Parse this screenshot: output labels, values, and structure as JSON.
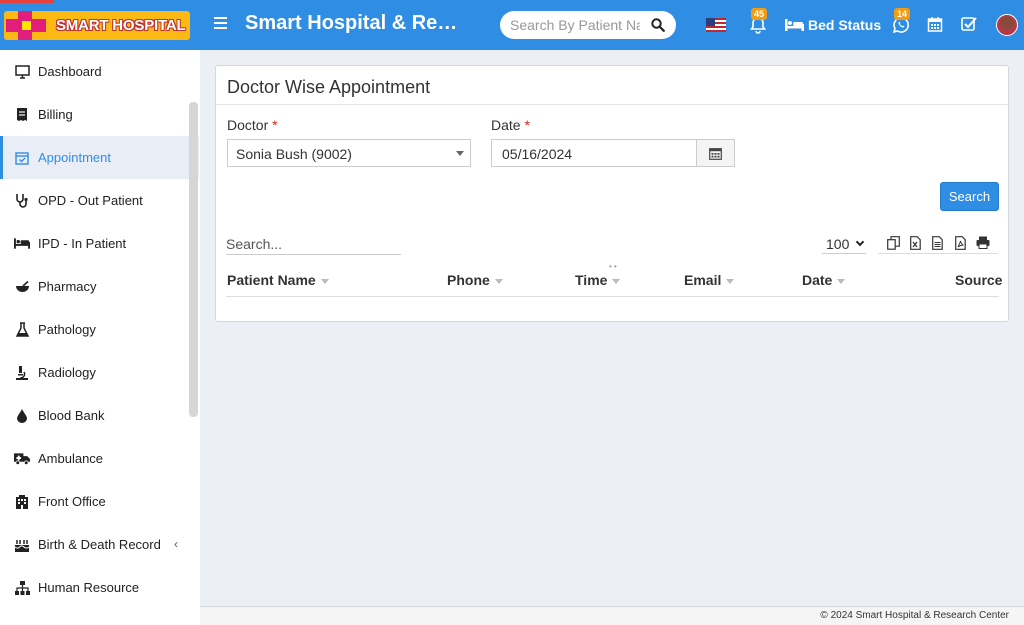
{
  "header": {
    "logo_text": "SMART HOSPITAL",
    "app_title": "Smart Hospital & Research Center",
    "search_placeholder": "Search By Patient Name",
    "notification_count": "45",
    "bed_status_label": "Bed Status",
    "whatsapp_count": "14"
  },
  "sidebar": {
    "items": [
      {
        "label": "Dashboard",
        "icon": "monitor-icon"
      },
      {
        "label": "Billing",
        "icon": "billing-icon"
      },
      {
        "label": "Appointment",
        "icon": "calendar-check-icon",
        "active": true
      },
      {
        "label": "OPD - Out Patient",
        "icon": "stethoscope-icon"
      },
      {
        "label": "IPD - In Patient",
        "icon": "bed-icon"
      },
      {
        "label": "Pharmacy",
        "icon": "mortar-icon"
      },
      {
        "label": "Pathology",
        "icon": "flask-icon"
      },
      {
        "label": "Radiology",
        "icon": "microscope-icon"
      },
      {
        "label": "Blood Bank",
        "icon": "drop-icon"
      },
      {
        "label": "Ambulance",
        "icon": "ambulance-icon"
      },
      {
        "label": "Front Office",
        "icon": "building-icon"
      },
      {
        "label": "Birth & Death Record",
        "icon": "cake-icon",
        "expandable": true
      },
      {
        "label": "Human Resource",
        "icon": "sitemap-icon"
      }
    ]
  },
  "main": {
    "title": "Doctor Wise Appointment",
    "doctor_label": "Doctor",
    "doctor_value": "Sonia Bush (9002)",
    "date_label": "Date",
    "date_value": "05/16/2024",
    "required_mark": "*",
    "search_button": "Search",
    "table_search_placeholder": "Search...",
    "page_length": "100",
    "columns": [
      "Patient Name",
      "Phone",
      "Time",
      "Email",
      "Date",
      "Source"
    ]
  },
  "footer": {
    "copyright": "© 2024 Smart Hospital & Research Center"
  },
  "colors": {
    "primary": "#2f8ee4",
    "logo_bg": "#fcb913",
    "badge": "#f39c12"
  }
}
